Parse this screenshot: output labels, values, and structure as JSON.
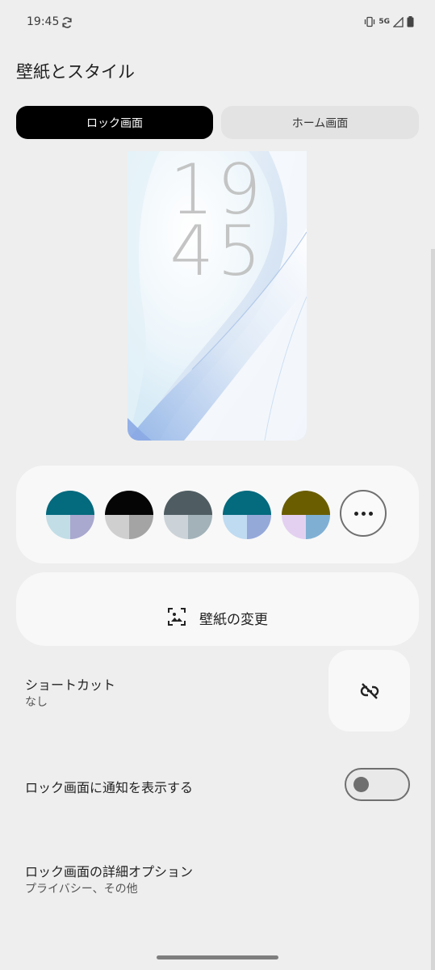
{
  "status_bar": {
    "time": "19:45",
    "network_label": "5G",
    "icons": [
      "sync-icon",
      "vibrate-icon",
      "signal-icon",
      "battery-icon"
    ]
  },
  "header": {
    "title": "壁紙とスタイル"
  },
  "tabs": [
    {
      "label": "ロック画面",
      "selected": true
    },
    {
      "label": "ホーム画面",
      "selected": false
    }
  ],
  "preview": {
    "clock_hour": "19",
    "clock_minute": "45"
  },
  "color_options": [
    {
      "top": "#046a7e",
      "bottom_left": "#c2dde6",
      "bottom_right": "#a9a8cf"
    },
    {
      "top": "#050505",
      "bottom_left": "#cfcfcf",
      "bottom_right": "#a4a4a4"
    },
    {
      "top": "#4f5d62",
      "bottom_left": "#ccd3d8",
      "bottom_right": "#a2b2b8"
    },
    {
      "top": "#046a7e",
      "bottom_left": "#bfdbf1",
      "bottom_right": "#95a9d9"
    },
    {
      "top": "#6a5d00",
      "bottom_left": "#e3d0f0",
      "bottom_right": "#7fb0d4"
    }
  ],
  "wallpaper_button": {
    "label": "壁紙の変更"
  },
  "settings": {
    "shortcut": {
      "title": "ショートカット",
      "subtitle": "なし"
    },
    "notifications": {
      "title": "ロック画面に通知を表示する",
      "enabled": false
    },
    "advanced": {
      "title": "ロック画面の詳細オプション",
      "subtitle": "プライバシー、その他"
    }
  }
}
